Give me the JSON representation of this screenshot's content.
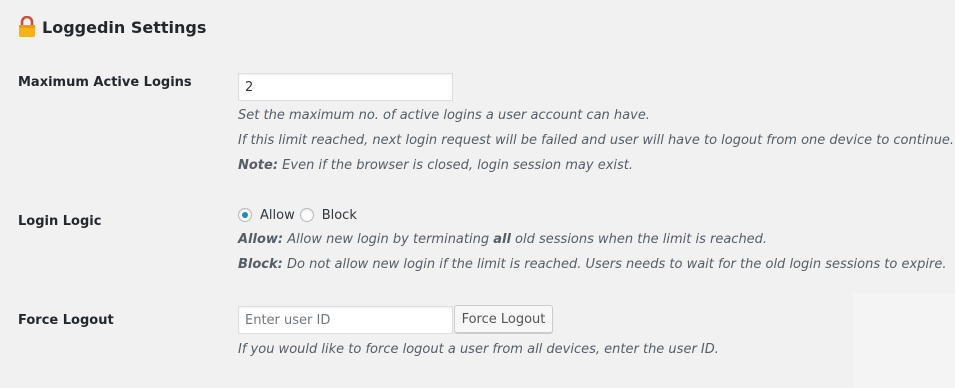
{
  "page": {
    "title": "Loggedin Settings",
    "title_icon": "lock-icon"
  },
  "max_logins": {
    "label": "Maximum Active Logins",
    "value": "2",
    "desc_line1": "Set the maximum no. of active logins a user account can have.",
    "desc_line2": "If this limit reached, next login request will be failed and user will have to logout from one device to continue.",
    "note_prefix": "Note:",
    "note_text": " Even if the browser is closed, login session may exist."
  },
  "login_logic": {
    "label": "Login Logic",
    "options": [
      {
        "label": "Allow",
        "checked": true
      },
      {
        "label": "Block",
        "checked": false
      }
    ],
    "allow_prefix": "Allow:",
    "allow_text_a": " Allow new login by terminating ",
    "allow_text_bold": "all",
    "allow_text_b": " old sessions when the limit is reached.",
    "block_prefix": "Block:",
    "block_text": " Do not allow new login if the limit is reached. Users needs to wait for the old login sessions to expire."
  },
  "force_logout": {
    "label": "Force Logout",
    "placeholder": "Enter user ID",
    "button_label": "Force Logout",
    "desc": "If you would like to force logout a user from all devices, enter the user ID."
  }
}
